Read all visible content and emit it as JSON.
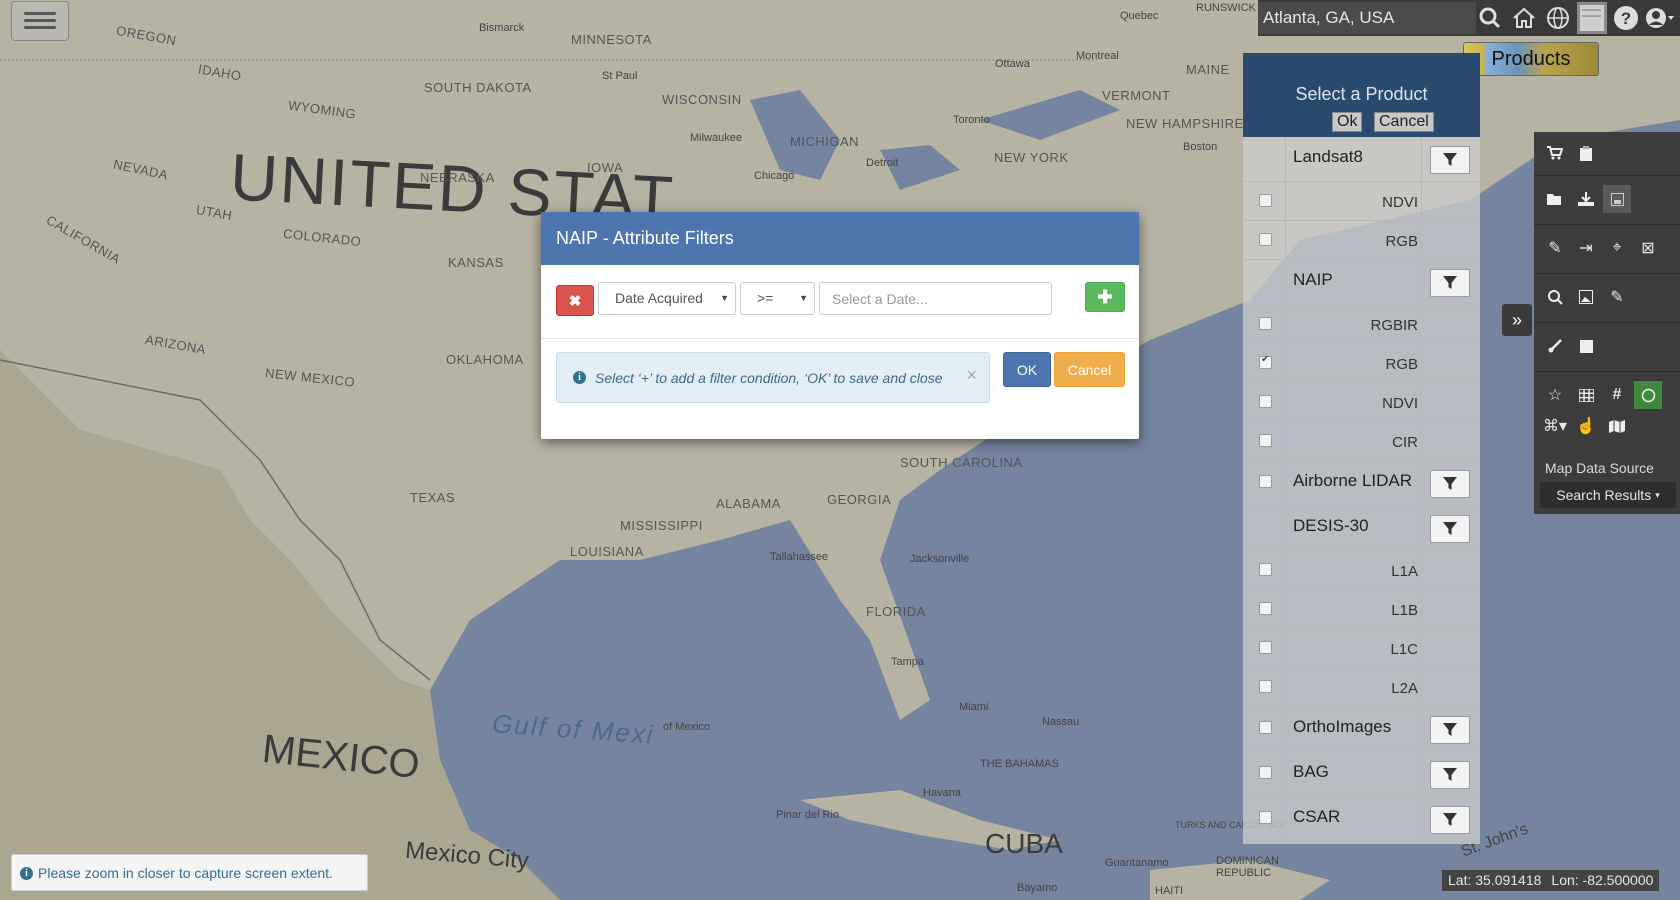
{
  "map": {
    "labels": {
      "united_states": "UNITED STAT",
      "mexico": "MEXICO",
      "cuba": "CUBA",
      "gulf": "Gulf of Mexi",
      "gulf_small": "of Mexico",
      "mexico_city": "Mexico City",
      "oregon": "OREGON",
      "idaho": "IDAHO",
      "wyoming": "WYOMING",
      "nevada": "NEVADA",
      "utah": "UTAH",
      "california": "CALIFORNIA",
      "colorado": "COLORADO",
      "arizona": "ARIZONA",
      "new_mexico": "NEW MEXICO",
      "kansas": "KANSAS",
      "oklahoma": "OKLAHOMA",
      "texas": "TEXAS",
      "nebraska": "NEBRASKA",
      "south_dakota": "SOUTH DAKOTA",
      "minnesota": "MINNESOTA",
      "iowa": "IOWA",
      "wisconsin": "WISCONSIN",
      "michigan": "MICHIGAN",
      "new_york": "NEW YORK",
      "vermont": "VERMONT",
      "new_hampshire": "NEW HAMPSHIRE",
      "maine": "MAINE",
      "south_carolina": "SOUTH CAROLINA",
      "georgia": "GEORGIA",
      "alabama": "ALABAMA",
      "mississippi": "MISSISSIPPI",
      "louisiana": "LOUISIANA",
      "florida": "FLORIDA",
      "the_bahamas": "THE BAHAMAS",
      "bismarck": "Bismarck",
      "st_paul": "St Paul",
      "milwaukee": "Milwaukee",
      "chicago": "Chicago",
      "detroit": "Detroit",
      "toronto": "Toronto",
      "ottawa": "Ottawa",
      "montreal": "Montreal",
      "boston": "Boston",
      "quebec": "Quebec",
      "brunswick": "RUNSWICK",
      "tallahassee": "Tallahassee",
      "jacksonville": "Jacksonville",
      "tampa": "Tampa",
      "miami": "Miami",
      "nassau": "Nassau",
      "havana": "Havana",
      "pinar_del_rio": "Pinar del Rio",
      "guantanamo": "Guantanamo",
      "bayamo": "Bayamo",
      "haiti": "HAITI",
      "dominican_republic": "DOMINICAN\nREPUBLIC",
      "st_johns": "St. John's",
      "turks_caicos": "TURKS AND CAICOS ISLA"
    }
  },
  "topbar": {
    "search_value": "Atlanta, GA, USA",
    "icons": [
      "search-icon",
      "home-icon",
      "globe-icon",
      "basemap-thumbnail",
      "help-icon",
      "user-icon"
    ]
  },
  "products_button": {
    "label": "Products"
  },
  "product_panel": {
    "title": "Select a Product",
    "ok_label": "Ok",
    "cancel_label": "Cancel",
    "groups": [
      {
        "name": "Landsat8",
        "has_checkbox": false,
        "filter": true
      },
      {
        "sub": "NDVI",
        "checked": false
      },
      {
        "sub": "RGB",
        "checked": false
      },
      {
        "name": "NAIP",
        "has_checkbox": false,
        "filter": true
      },
      {
        "sub": "RGBIR",
        "checked": false
      },
      {
        "sub": "RGB",
        "checked": true
      },
      {
        "sub": "NDVI",
        "checked": false
      },
      {
        "sub": "CIR",
        "checked": false
      },
      {
        "name": "Airborne LIDAR",
        "has_checkbox": true,
        "filter": true
      },
      {
        "name": "DESIS-30",
        "has_checkbox": false,
        "filter": true
      },
      {
        "sub": "L1A",
        "checked": false
      },
      {
        "sub": "L1B",
        "checked": false
      },
      {
        "sub": "L1C",
        "checked": false
      },
      {
        "sub": "L2A",
        "checked": false
      },
      {
        "name": "OrthoImages",
        "has_checkbox": true,
        "filter": true
      },
      {
        "name": "BAG",
        "has_checkbox": true,
        "filter": true
      },
      {
        "name": "CSAR",
        "has_checkbox": true,
        "filter": true
      }
    ]
  },
  "side_toolbar": {
    "collapse_icon": "double-chevron-right-icon",
    "map_data_source_label": "Map Data Source",
    "map_data_source_value": "Search Results"
  },
  "modal": {
    "title": "NAIP - Attribute Filters",
    "field_select": "Date Acquired",
    "operator_select": ">=",
    "date_placeholder": "Select a Date...",
    "info_message": "Select ‘+’ to add a filter condition, ‘OK’ to save and close",
    "ok_label": "OK",
    "cancel_label": "Cancel"
  },
  "zoom_notice": {
    "message": "Please zoom in closer to capture screen extent."
  },
  "coords": {
    "lat": "Lat: 35.091418",
    "lon": "Lon: -82.500000"
  },
  "colors": {
    "modal_header": "#4e75ad",
    "remove_button": "#d9534f",
    "add_button": "#5cb85c",
    "cancel_button": "#f0ad4e",
    "panel_header": "#2a4a6e"
  }
}
